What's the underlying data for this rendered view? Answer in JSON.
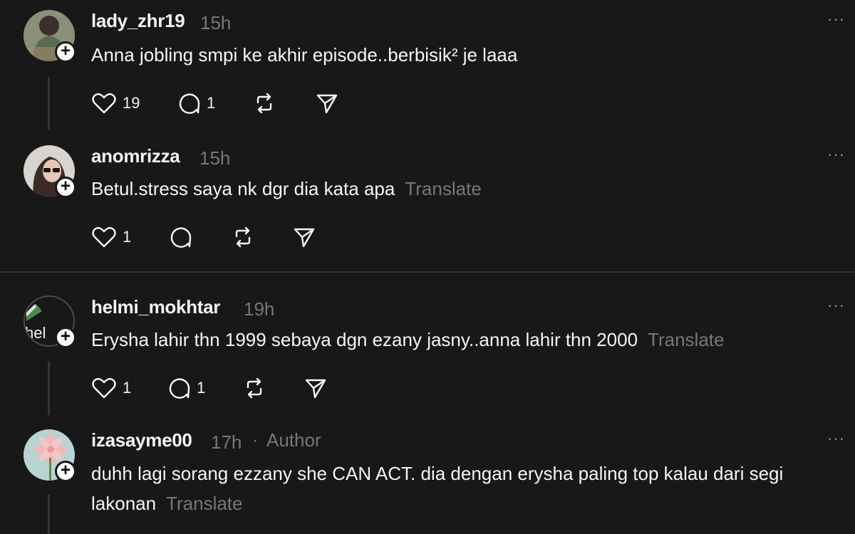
{
  "posts": [
    {
      "username": "lady_zhr19",
      "time": "15h",
      "text": "Anna jobling smpi ke akhir episode..berbisik² je laaa",
      "translate": "",
      "likes": "19",
      "comments": "1",
      "more": "···"
    },
    {
      "username": "anomrizza",
      "time": "15h",
      "text": "Betul.stress saya nk dgr dia kata apa",
      "translate": "Translate",
      "likes": "1",
      "comments": "",
      "more": "···"
    },
    {
      "username": "helmi_mokhtar",
      "time": "19h",
      "text": "Erysha lahir thn 1999 sebaya dgn ezany jasny..anna lahir thn 2000",
      "translate": "Translate",
      "likes": "1",
      "comments": "1",
      "more": "···",
      "avatar_text": "hel"
    },
    {
      "username": "izasayme00",
      "time": "17h",
      "separator": "·",
      "author": "Author",
      "text": "duhh lagi sorang ezzany she CAN ACT. dia dengan erysha paling top kalau dari segi lakonan",
      "translate": "Translate",
      "more": "···"
    }
  ],
  "plus_symbol": "+",
  "icons": [
    "heart-icon",
    "comment-icon",
    "repost-icon",
    "share-icon",
    "more-icon",
    "follow-plus-icon"
  ],
  "colors": {
    "background": "#181818",
    "text": "#f3f5f7",
    "muted": "#777777",
    "line": "#333638"
  }
}
